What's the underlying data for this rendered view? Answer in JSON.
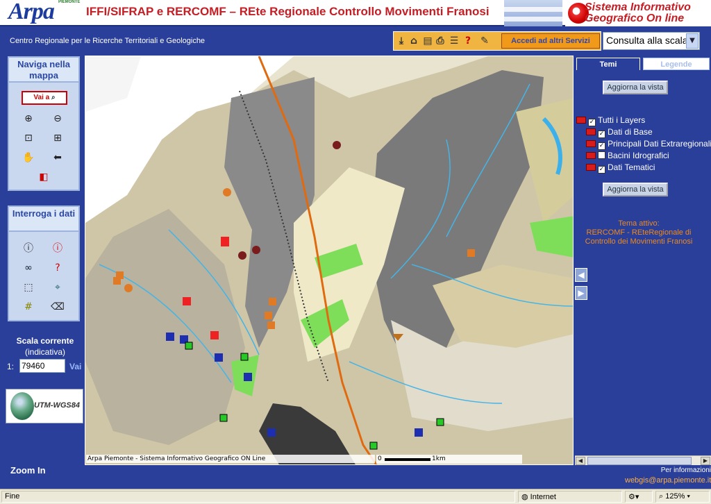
{
  "header": {
    "logo_text": "Arpa",
    "logo_sub": "PIEMONTE",
    "title": "IFFI/SIFRAP e RERCOMF – REte Regionale Controllo Movimenti Franosi",
    "brand_line1": "Sistema Informativo",
    "brand_line2": "Geografico On line"
  },
  "subheader": {
    "org": "Centro Regionale per le Ricerche Territoriali e Geologiche",
    "services_button": "Accedi ad altri Servizi",
    "scale_select": "Consulta alla scala"
  },
  "toolbar_icons": [
    "download-icon",
    "home-icon",
    "print-icon",
    "print-map-icon",
    "layers-icon",
    "help-icon",
    "edit-icon"
  ],
  "nav_panel": {
    "title": "Naviga nella mappa",
    "vai_button": "Vai a",
    "tools": [
      "zoom-in-icon",
      "zoom-out-icon",
      "zoom-window-icon",
      "zoom-full-icon",
      "pan-hand-icon",
      "back-arrow-icon",
      "overview-icon"
    ]
  },
  "query_panel": {
    "title": "Interroga i dati",
    "tools": [
      "info-black-icon",
      "info-red-icon",
      "binoculars-icon",
      "query-form-icon",
      "select-area-icon",
      "select-feature-icon",
      "measure-grid-icon",
      "eraser-icon"
    ]
  },
  "scale": {
    "title": "Scala corrente",
    "subtitle": "(indicativa)",
    "label": "1:",
    "value": "79460",
    "go": "Vai"
  },
  "projection": "UTM-WGS84",
  "status_text": "Zoom In",
  "map": {
    "credit": "Arpa Piemonte - Sistema Informativo Geografico ON Line",
    "scale_start": "0",
    "scale_end": "1km"
  },
  "right_panel": {
    "tabs": [
      "Temi",
      "Legende"
    ],
    "refresh_label": "Aggiorna la vista",
    "layers": [
      {
        "label": "Tutti i Layers",
        "checked": true,
        "indent": 0
      },
      {
        "label": "Dati di Base",
        "checked": true,
        "indent": 1
      },
      {
        "label": "Principali Dati Extraregionali",
        "checked": true,
        "indent": 1
      },
      {
        "label": "Bacini Idrografici",
        "checked": false,
        "indent": 1
      },
      {
        "label": "Dati Tematici",
        "checked": true,
        "indent": 1
      }
    ],
    "active_theme_label": "Tema attivo:",
    "active_theme": "RERCOMF - REteRegionale di Controllo dei Movimenti Franosi"
  },
  "footer": {
    "info": "Per informazioni",
    "email": "webgis@arpa.piemonte.it"
  },
  "statusbar": {
    "left": "Fine",
    "zone": "Internet",
    "zoom": "125%"
  },
  "colors": {
    "page_bg": "#2a3f9a",
    "title_red": "#c51d24",
    "panel_bg": "#c9d8ef",
    "accent_orange": "#f08a1a"
  }
}
